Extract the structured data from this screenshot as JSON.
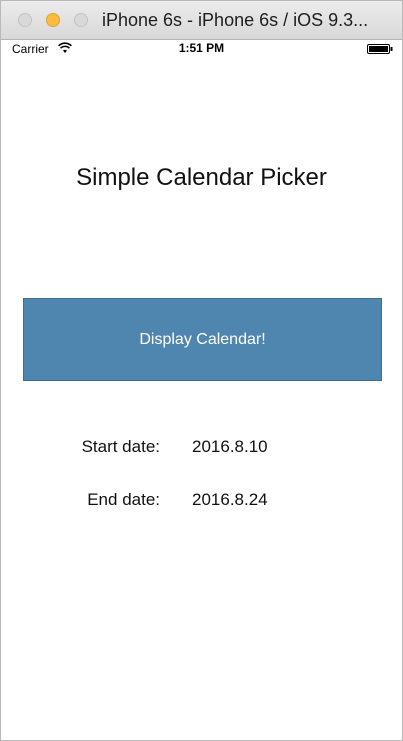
{
  "window": {
    "title": "iPhone 6s - iPhone 6s / iOS 9.3..."
  },
  "statusbar": {
    "carrier": "Carrier",
    "time": "1:51 PM",
    "icons": [
      "wifi-icon",
      "battery-icon"
    ]
  },
  "main": {
    "title": "Simple Calendar Picker",
    "button_label": "Display Calendar!",
    "start_label": "Start date:",
    "start_value": "2016.8.10",
    "end_label": "End date:",
    "end_value": "2016.8.24"
  },
  "colors": {
    "button_bg": "#4f86b0",
    "button_text": "#ffffff",
    "minimize_yellow": "#fdbc40"
  }
}
